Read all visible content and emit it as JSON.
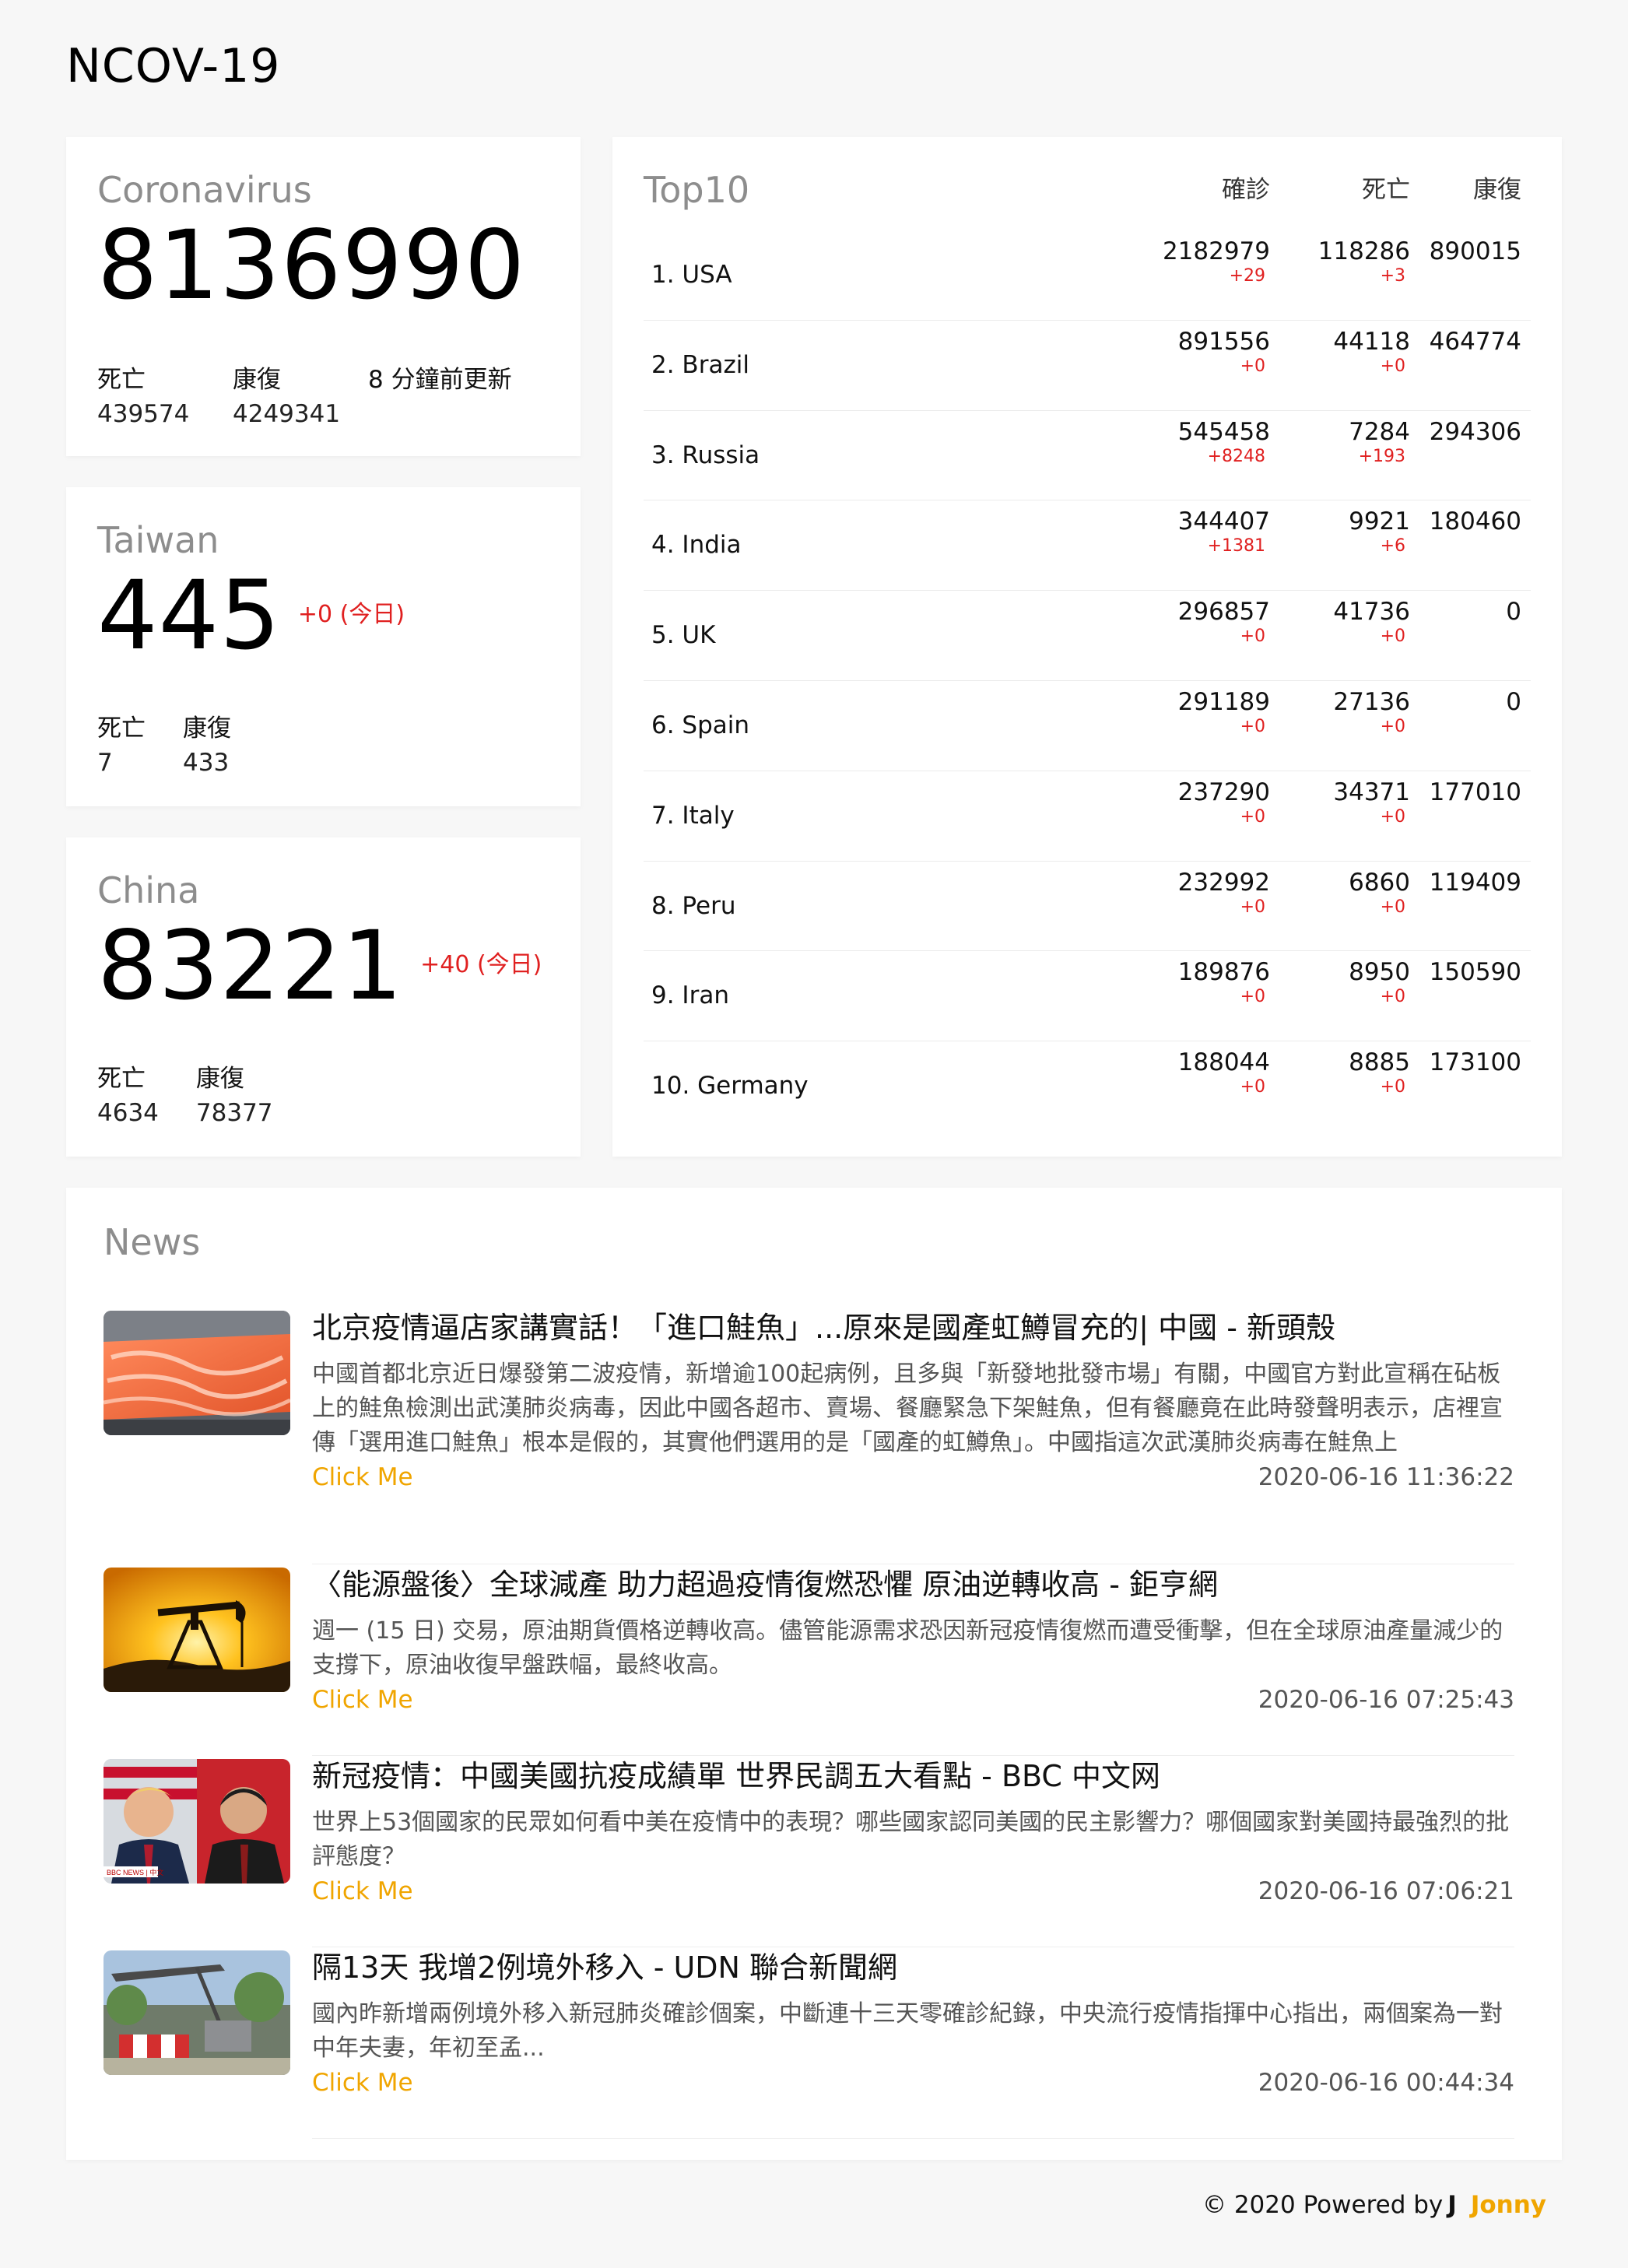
{
  "app": {
    "title": "NCOV-19"
  },
  "global": {
    "label": "Coronavirus",
    "total": "8136990",
    "deaths_label": "死亡",
    "deaths": "439574",
    "recovered_label": "康復",
    "recovered": "4249341",
    "updated": "8 分鐘前更新"
  },
  "taiwan": {
    "label": "Taiwan",
    "total": "445",
    "delta": "+0 (今日)",
    "deaths_label": "死亡",
    "deaths": "7",
    "recovered_label": "康復",
    "recovered": "433"
  },
  "china": {
    "label": "China",
    "total": "83221",
    "delta": "+40 (今日)",
    "deaths_label": "死亡",
    "deaths": "4634",
    "recovered_label": "康復",
    "recovered": "78377"
  },
  "top10": {
    "title": "Top10",
    "columns": [
      "確診",
      "死亡",
      "康復"
    ],
    "rows": [
      {
        "country": "1. USA",
        "confirmed": "2182979",
        "confirmed_delta": "+29",
        "deaths": "118286",
        "deaths_delta": "+3",
        "recovered": "890015"
      },
      {
        "country": "2. Brazil",
        "confirmed": "891556",
        "confirmed_delta": "+0",
        "deaths": "44118",
        "deaths_delta": "+0",
        "recovered": "464774"
      },
      {
        "country": "3. Russia",
        "confirmed": "545458",
        "confirmed_delta": "+8248",
        "deaths": "7284",
        "deaths_delta": "+193",
        "recovered": "294306"
      },
      {
        "country": "4. India",
        "confirmed": "344407",
        "confirmed_delta": "+1381",
        "deaths": "9921",
        "deaths_delta": "+6",
        "recovered": "180460"
      },
      {
        "country": "5. UK",
        "confirmed": "296857",
        "confirmed_delta": "+0",
        "deaths": "41736",
        "deaths_delta": "+0",
        "recovered": "0"
      },
      {
        "country": "6. Spain",
        "confirmed": "291189",
        "confirmed_delta": "+0",
        "deaths": "27136",
        "deaths_delta": "+0",
        "recovered": "0"
      },
      {
        "country": "7. Italy",
        "confirmed": "237290",
        "confirmed_delta": "+0",
        "deaths": "34371",
        "deaths_delta": "+0",
        "recovered": "177010"
      },
      {
        "country": "8. Peru",
        "confirmed": "232992",
        "confirmed_delta": "+0",
        "deaths": "6860",
        "deaths_delta": "+0",
        "recovered": "119409"
      },
      {
        "country": "9. Iran",
        "confirmed": "189876",
        "confirmed_delta": "+0",
        "deaths": "8950",
        "deaths_delta": "+0",
        "recovered": "150590"
      },
      {
        "country": "10. Germany",
        "confirmed": "188044",
        "confirmed_delta": "+0",
        "deaths": "8885",
        "deaths_delta": "+0",
        "recovered": "173100"
      }
    ]
  },
  "news": {
    "title": "News",
    "items": [
      {
        "headline": "北京疫情逼店家講實話！「進口鮭魚」...原來是國產虹鱒冒充的| 中國 - 新頭殼",
        "summary": "中國首都北京近日爆發第二波疫情，新增逾100起病例，且多與「新發地批發市場」有關，中國官方對此宣稱在砧板上的鮭魚檢測出武漢肺炎病毒，因此中國各超市、賣場、餐廳緊急下架鮭魚，但有餐廳竟在此時發聲明表示，店裡宣傳「選用進口鮭魚」根本是假的，其實他們選用的是「國產的虹鱒魚」。中國指這次武漢肺炎病毒在鮭魚上",
        "link": "Click Me",
        "time": "2020-06-16 11:36:22",
        "thumb": "salmon"
      },
      {
        "headline": "〈能源盤後〉全球減產 助力超過疫情復燃恐懼 原油逆轉收高 - 鉅亨網",
        "summary": "週一 (15 日) 交易，原油期貨價格逆轉收高。儘管能源需求恐因新冠疫情復燃而遭受衝擊，但在全球原油產量減少的支撐下，原油收復早盤跌幅，最終收高。",
        "link": "Click Me",
        "time": "2020-06-16 07:25:43",
        "thumb": "oil"
      },
      {
        "headline": "新冠疫情：中國美國抗疫成績單 世界民調五大看點 - BBC 中文网",
        "summary": "世界上53個國家的民眾如何看中美在疫情中的表現？哪些國家認同美國的民主影響力？哪個國家對美國持最強烈的批評態度？",
        "link": "Click Me",
        "time": "2020-06-16 07:06:21",
        "thumb": "bbc",
        "thumb_caption": "BBC NEWS | 中文"
      },
      {
        "headline": "隔13天 我增2例境外移入 - UDN 聯合新聞網",
        "summary": "國內昨新增兩例境外移入新冠肺炎確診個案，中斷連十三天零確診紀錄，中央流行疫情指揮中心指出，兩個案為一對中年夫妻，年初至孟...",
        "link": "Click Me",
        "time": "2020-06-16 00:44:34",
        "thumb": "crane"
      }
    ]
  },
  "footer": {
    "text": "© 2020 Powered by",
    "mark": "J",
    "name": "Jonny"
  },
  "colors": {
    "accent": "#f0a500",
    "delta": "#e02020",
    "muted": "#8d8d8d"
  }
}
